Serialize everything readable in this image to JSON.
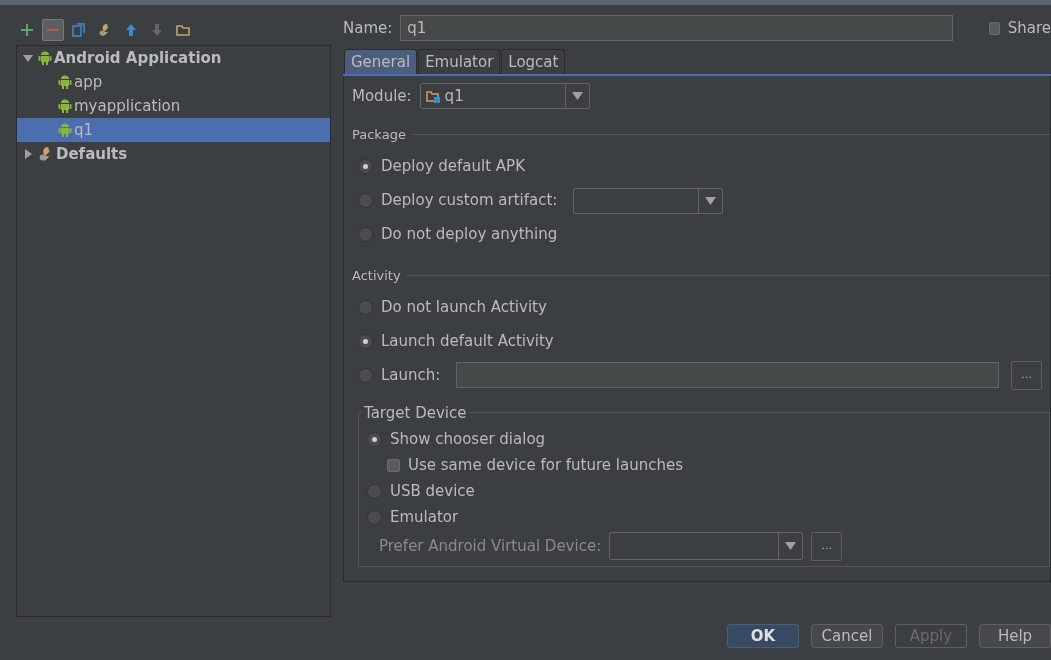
{
  "toolbar": [
    {
      "kind": "add",
      "disabled": false,
      "hovered": false
    },
    {
      "kind": "remove",
      "disabled": false,
      "hovered": true
    },
    {
      "kind": "copy",
      "disabled": false,
      "hovered": false
    },
    {
      "kind": "wrench",
      "disabled": false,
      "hovered": false
    },
    {
      "kind": "up",
      "disabled": false,
      "hovered": false
    },
    {
      "kind": "down",
      "disabled": true,
      "hovered": false
    },
    {
      "kind": "folder",
      "disabled": false,
      "hovered": false
    }
  ],
  "tree": [
    {
      "label": "Android Application",
      "kind": "android",
      "expanded": true,
      "selected": false,
      "children": [
        {
          "label": "app",
          "kind": "android",
          "selected": false
        },
        {
          "label": "myapplication",
          "kind": "android",
          "selected": false
        },
        {
          "label": "q1",
          "kind": "android",
          "selected": true
        }
      ]
    },
    {
      "label": "Defaults",
      "kind": "defaults",
      "expanded": false,
      "selected": false
    }
  ],
  "name_field": {
    "label": "Name:",
    "value": "q1"
  },
  "share": {
    "label": "Share",
    "checked": false
  },
  "tabs": [
    {
      "label": "General",
      "selected": true
    },
    {
      "label": "Emulator",
      "selected": false
    },
    {
      "label": "Logcat",
      "selected": false
    }
  ],
  "module": {
    "label": "Module:",
    "value": "q1"
  },
  "package": {
    "title": "Package",
    "options": [
      {
        "label": "Deploy default APK",
        "kind": "plain",
        "selected": true
      },
      {
        "label": "Deploy custom artifact:",
        "kind": "combo",
        "selected": false
      },
      {
        "label": "Do not deploy anything",
        "kind": "plain",
        "selected": false
      }
    ]
  },
  "activity": {
    "title": "Activity",
    "options": [
      {
        "label": "Do not launch Activity",
        "kind": "plain",
        "selected": false
      },
      {
        "label": "Launch default Activity",
        "kind": "plain",
        "selected": true
      },
      {
        "label": "Launch:",
        "kind": "field",
        "selected": false,
        "button": "…"
      }
    ]
  },
  "target": {
    "title": "Target Device",
    "options": [
      {
        "label": "Show chooser dialog",
        "kind": "radio",
        "selected": true
      },
      {
        "label": "Use same device for future launches",
        "kind": "checkbox",
        "checked": false
      },
      {
        "label": "USB device",
        "kind": "radio",
        "selected": false
      },
      {
        "label": "Emulator",
        "kind": "radio",
        "selected": false
      },
      {
        "label": "Prefer Android Virtual Device:",
        "kind": "combo",
        "disabled": true,
        "button": "…"
      }
    ]
  },
  "buttons": [
    {
      "label": "OK",
      "kind": "default",
      "disabled": false
    },
    {
      "label": "Cancel",
      "kind": "normal",
      "disabled": false
    },
    {
      "label": "Apply",
      "kind": "normal",
      "disabled": true
    },
    {
      "label": "Help",
      "kind": "normal",
      "disabled": false
    }
  ]
}
